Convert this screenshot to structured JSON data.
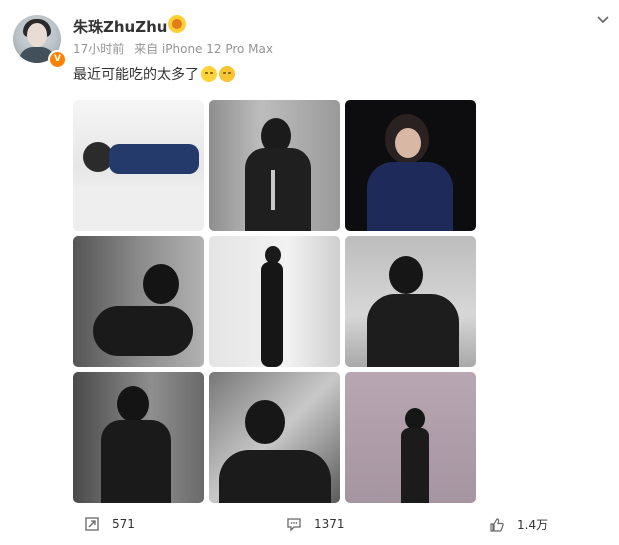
{
  "post": {
    "username": "朱珠ZhuZhu",
    "time": "17小时前",
    "source": "来自 iPhone 12 Pro Max",
    "text": "最近可能吃的太多了",
    "emojis": [
      "thinking-emoji",
      "sweat-smile-emoji"
    ]
  },
  "photos": [
    {
      "icon": "photo-lying-on-bed"
    },
    {
      "icon": "photo-black-dress-sitting"
    },
    {
      "icon": "photo-dark-portrait"
    },
    {
      "icon": "photo-reclining-bw"
    },
    {
      "icon": "photo-standing-silhouette"
    },
    {
      "icon": "photo-sofa-portrait"
    },
    {
      "icon": "photo-standing-closeup"
    },
    {
      "icon": "photo-hand-near-face"
    },
    {
      "icon": "photo-event-backdrop"
    }
  ],
  "actions": {
    "repost_count": "571",
    "comment_count": "1371",
    "like_count": "1.4万"
  },
  "colors": {
    "accent": "#ff8200",
    "text": "#333333",
    "meta": "#939393"
  }
}
